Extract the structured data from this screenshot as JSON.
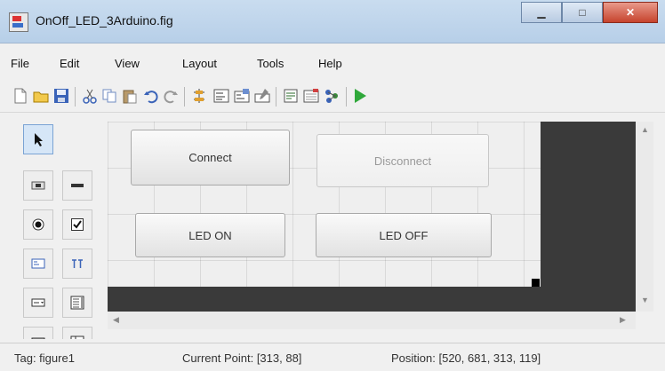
{
  "window": {
    "title": "OnOff_LED_3Arduino.fig",
    "minimize_label": "▁",
    "maximize_label": "□",
    "close_label": "✕"
  },
  "menu": [
    "File",
    "Edit",
    "View",
    "Layout",
    "Tools",
    "Help"
  ],
  "toolbar_icons": [
    "new-file-icon",
    "open-folder-icon",
    "save-icon",
    "cut-icon",
    "copy-icon",
    "paste-icon",
    "undo-icon",
    "redo-icon",
    "align-objects-icon",
    "menu-editor-icon",
    "tab-order-editor-icon",
    "toolbar-editor-icon",
    "editor-icon",
    "property-inspector-icon",
    "object-browser-icon",
    "run-figure-icon"
  ],
  "palette_tools": [
    "select-tool-icon",
    "push-button-tool-icon",
    "slider-tool-icon",
    "radio-button-tool-icon",
    "checkbox-tool-icon",
    "edit-text-tool-icon",
    "static-text-tool-icon",
    "popup-menu-tool-icon",
    "listbox-tool-icon",
    "toggle-button-tool-icon",
    "table-tool-icon"
  ],
  "buttons": {
    "connect": "Connect",
    "disconnect": "Disconnect",
    "led_on": "LED ON",
    "led_off": "LED OFF"
  },
  "status": {
    "tag": "Tag: figure1",
    "current_point": "Current Point: [313, 88]",
    "position": "Position: [520, 681, 313, 119]"
  }
}
